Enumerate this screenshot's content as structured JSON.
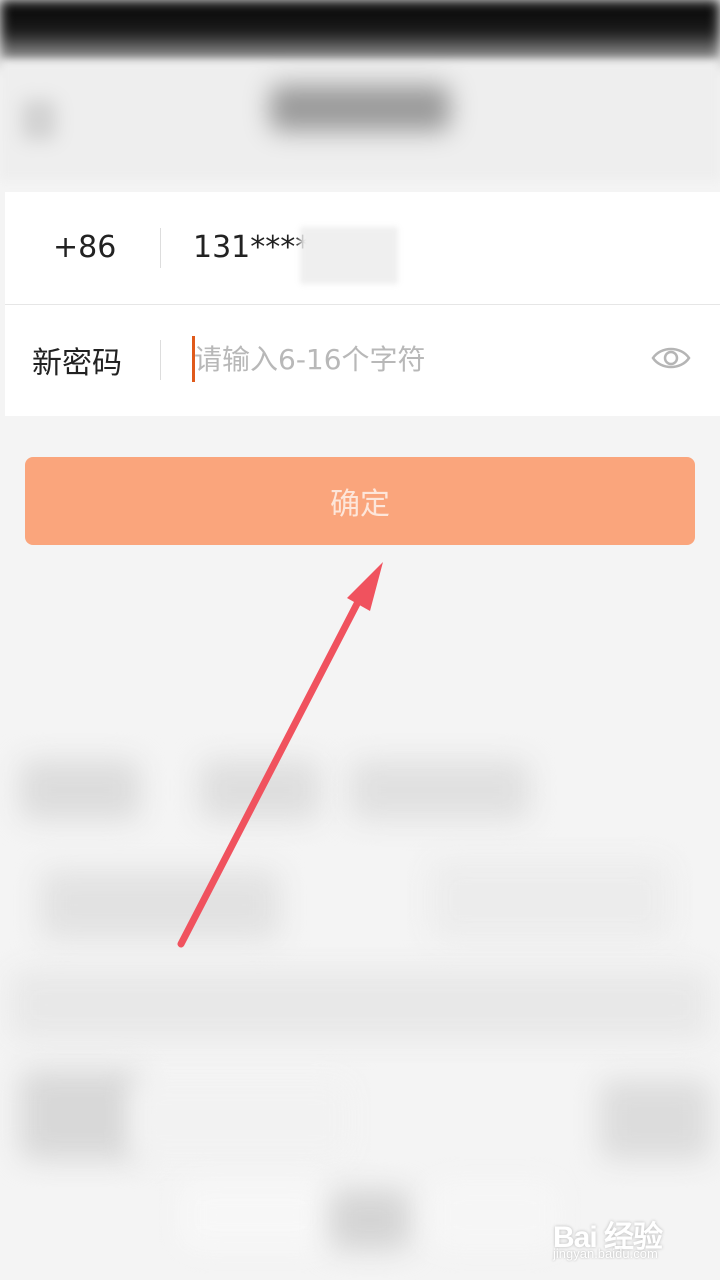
{
  "form": {
    "country_code": "+86",
    "phone_visible": "131****",
    "password_label": "新密码",
    "password_placeholder": "请输入6-16个字符",
    "password_value": ""
  },
  "confirm_label": "确定",
  "watermark": {
    "brand": "Bai 经验",
    "url": "jingyan.baidu.com"
  },
  "colors": {
    "accent": "#faa57c",
    "cursor": "#e05a1b",
    "arrow": "#f0525e"
  },
  "icons": {
    "visibility": "eye-icon",
    "annotation": "red-arrow"
  }
}
